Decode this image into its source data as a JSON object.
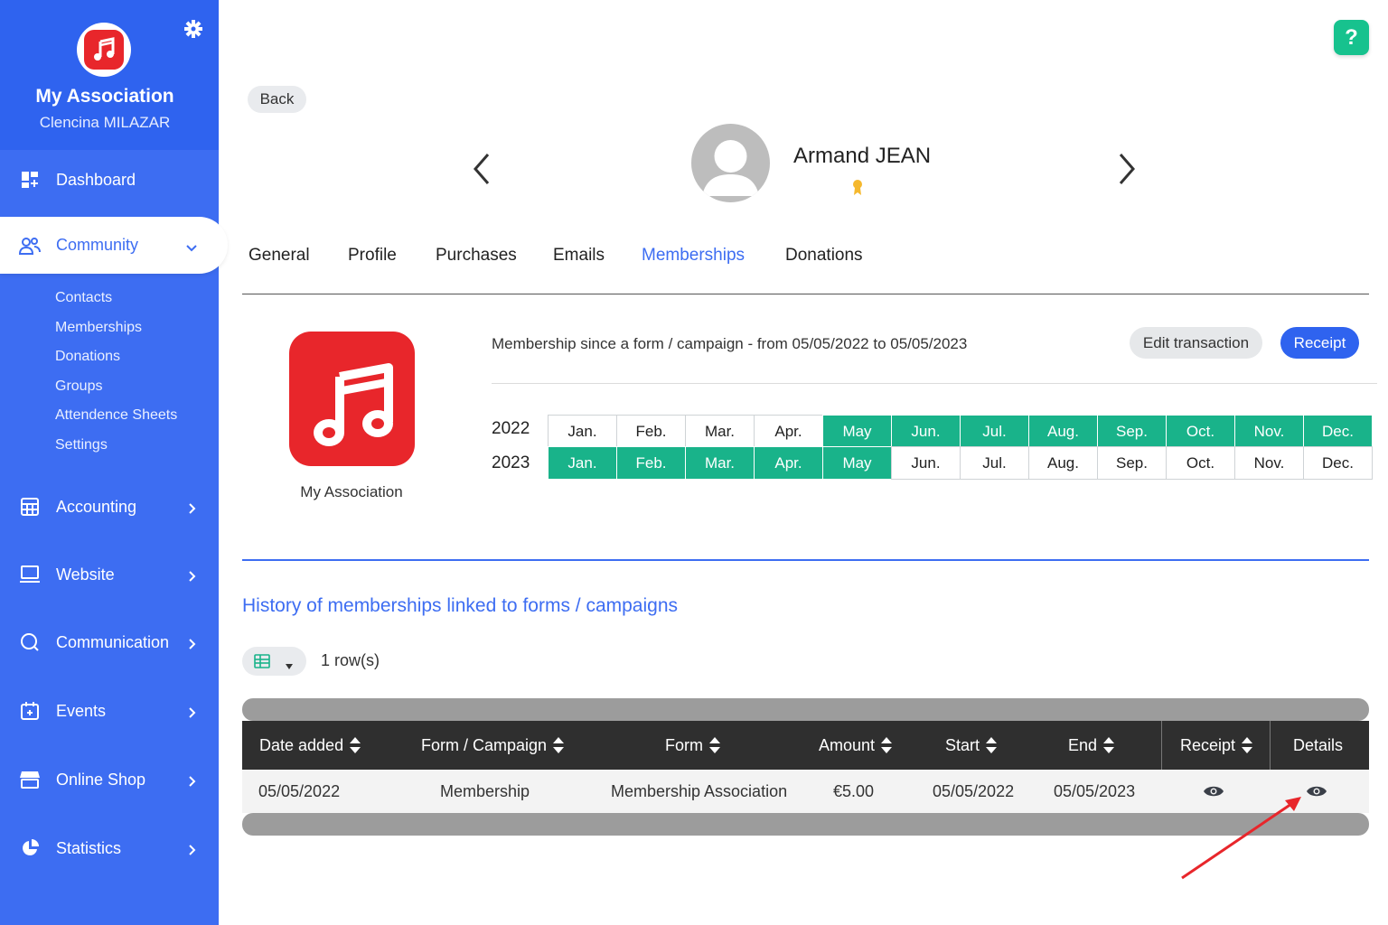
{
  "sidebar": {
    "org_name": "My Association",
    "user_name": "Clencina MILAZAR",
    "items": {
      "dashboard": "Dashboard",
      "community": "Community",
      "accounting": "Accounting",
      "website": "Website",
      "communication": "Communication",
      "events": "Events",
      "online_shop": "Online Shop",
      "statistics": "Statistics"
    },
    "community_sub": {
      "contacts": "Contacts",
      "memberships": "Memberships",
      "donations": "Donations",
      "groups": "Groups",
      "attendance": "Attendence Sheets",
      "settings": "Settings"
    },
    "colors": {
      "sidebar": "#3d6df2",
      "header": "#2f63ef"
    }
  },
  "header": {
    "help_label": "?",
    "back_label": "Back",
    "contact_name": "Armand JEAN"
  },
  "tabs": {
    "general": "General",
    "profile": "Profile",
    "purchases": "Purchases",
    "emails": "Emails",
    "memberships": "Memberships",
    "donations": "Donations",
    "active": "Memberships"
  },
  "membership": {
    "app_label": "My Association",
    "description": "Membership since a form / campaign - from 05/05/2022 to 05/05/2023",
    "edit_label": "Edit transaction",
    "receipt_label": "Receipt",
    "year1": "2022",
    "year2": "2023",
    "months": [
      "Jan.",
      "Feb.",
      "Mar.",
      "Apr.",
      "May",
      "Jun.",
      "Jul.",
      "Aug.",
      "Sep.",
      "Oct.",
      "Nov.",
      "Dec."
    ],
    "active_2022": [
      false,
      false,
      false,
      false,
      true,
      true,
      true,
      true,
      true,
      true,
      true,
      true
    ],
    "active_2023": [
      true,
      true,
      true,
      true,
      true,
      false,
      false,
      false,
      false,
      false,
      false,
      false
    ],
    "active_color": "#19b38a"
  },
  "history": {
    "title": "History of memberships linked to forms / campaigns",
    "row_count": "1 row(s)",
    "columns": {
      "date_added": "Date added",
      "form_campaign": "Form / Campaign",
      "form": "Form",
      "amount": "Amount",
      "start": "Start",
      "end": "End",
      "receipt": "Receipt",
      "details": "Details"
    },
    "rows": [
      {
        "date_added": "05/05/2022",
        "form_campaign": "Membership",
        "form": "Membership Association",
        "amount": "€5.00",
        "start": "05/05/2022",
        "end": "05/05/2023"
      }
    ]
  }
}
